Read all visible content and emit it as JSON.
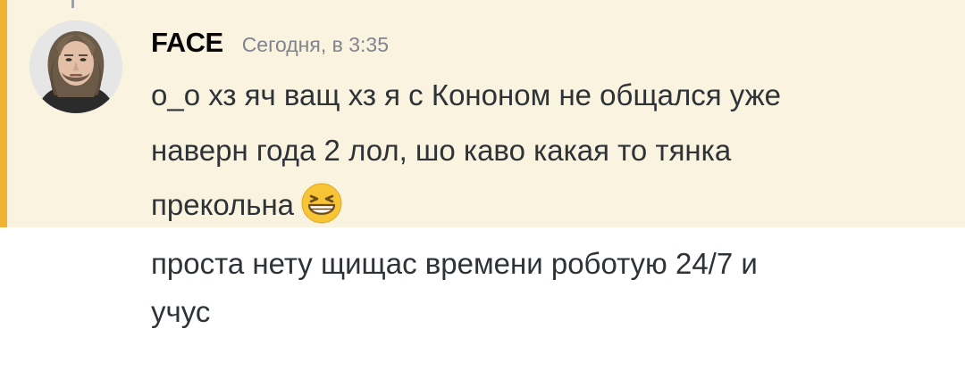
{
  "message": {
    "author": "FACE",
    "timestamp": "Сегодня, в 3:35",
    "lines": [
      "о_о хз яч ващ хз я с Кононом не общался уже",
      "наверн года 2 лол, шо каво какая то тянка",
      "прекольна"
    ],
    "emoji": "grinning-squinting-face"
  },
  "followup": {
    "lines": [
      "проста нету щищас времени роботую 24/7 и",
      "учус"
    ]
  },
  "colors": {
    "highlight_background": "#faf3e0",
    "accent_bar": "#f0b232",
    "author_text": "#060607",
    "timestamp_text": "#80848e",
    "message_text": "#2e3338"
  }
}
